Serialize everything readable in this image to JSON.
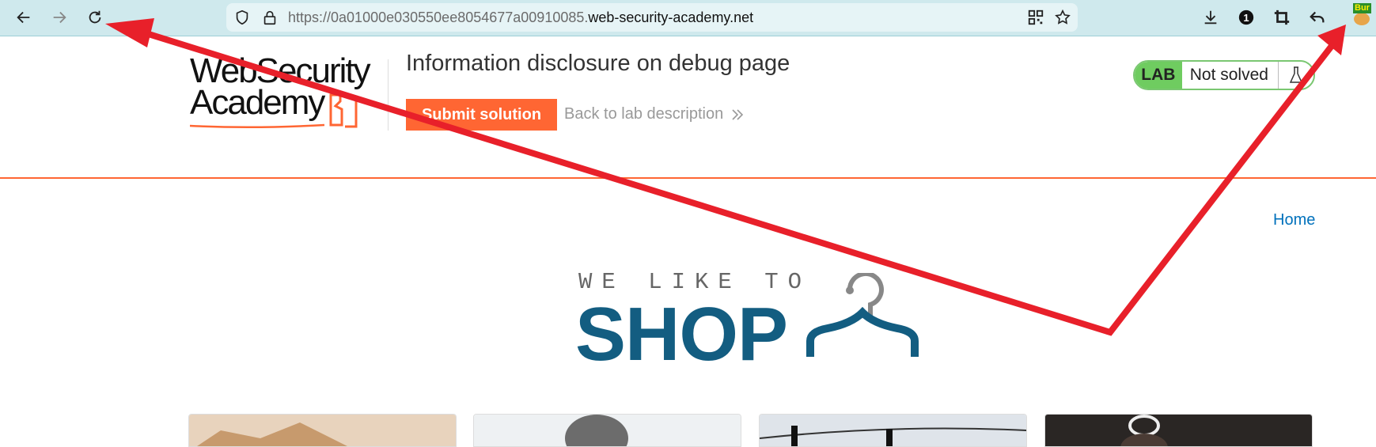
{
  "browser": {
    "url_prefix": "https://0a01000e030550ee8054677a00910085.",
    "url_host": "web-security-academy.net",
    "extension_label": "Bur",
    "icons": [
      "back-icon",
      "forward-icon",
      "reload-icon",
      "shield-icon",
      "lock-icon",
      "qr-code-icon",
      "star-icon",
      "download-icon",
      "counter-badge-icon",
      "crop-icon",
      "undo-icon",
      "extension-icon"
    ],
    "counter_badge": "1"
  },
  "header": {
    "logo_line1": "WebSecurity",
    "logo_line2": "Academy",
    "lab_title": "Information disclosure on debug page",
    "submit_label": "Submit solution",
    "back_label": "Back to lab description",
    "lab_badge": "LAB",
    "lab_status": "Not solved"
  },
  "shop": {
    "home_link": "Home",
    "tagline": "WE LIKE TO",
    "brand": "SHOP"
  },
  "colors": {
    "accent": "#ff6633",
    "brand_blue": "#135d81",
    "link": "#0071bc",
    "lab_green": "#6fcc60",
    "annotation_red": "#e8202a"
  }
}
